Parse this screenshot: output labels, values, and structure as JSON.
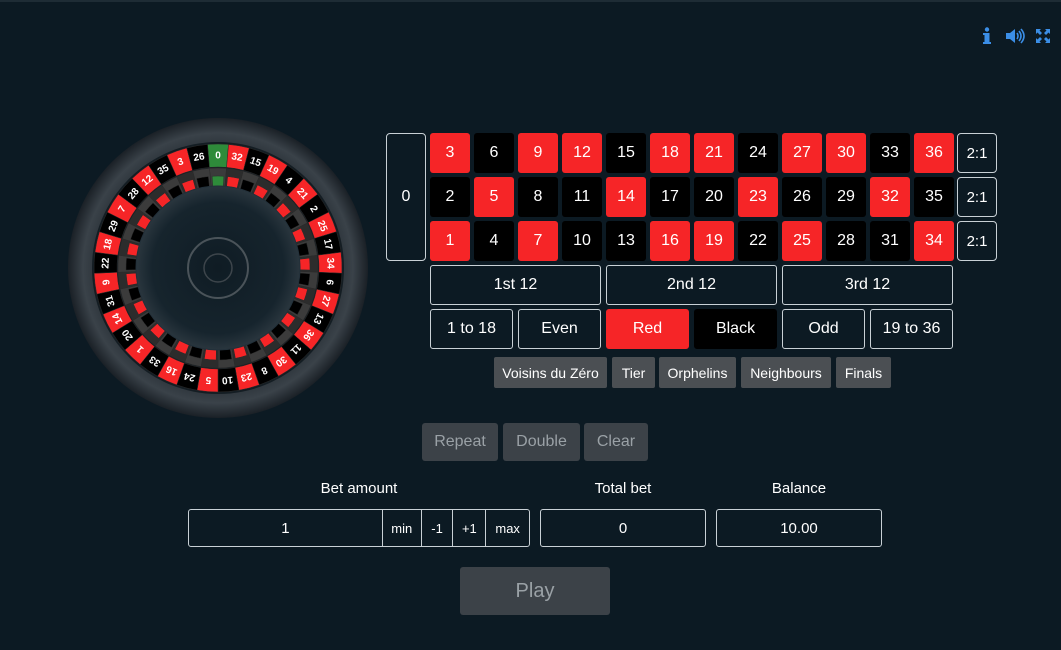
{
  "toolbar": {
    "info_icon": "info-icon",
    "sound_icon": "sound-icon",
    "fullscreen_icon": "fullscreen-icon"
  },
  "wheel": {
    "sequence": [
      "0",
      "32",
      "15",
      "19",
      "4",
      "21",
      "2",
      "25",
      "17",
      "34",
      "6",
      "27",
      "13",
      "36",
      "11",
      "30",
      "8",
      "23",
      "10",
      "5",
      "24",
      "16",
      "33",
      "1",
      "20",
      "14",
      "31",
      "9",
      "22",
      "18",
      "29",
      "7",
      "28",
      "12",
      "35",
      "3",
      "26"
    ],
    "colors": {
      "red": "#f62527",
      "black": "#000000",
      "green": "#2e8b3a"
    }
  },
  "table": {
    "zero": "0",
    "rows": [
      [
        {
          "n": "3",
          "c": "red"
        },
        {
          "n": "6",
          "c": "black"
        },
        {
          "n": "9",
          "c": "red"
        },
        {
          "n": "12",
          "c": "red"
        },
        {
          "n": "15",
          "c": "black"
        },
        {
          "n": "18",
          "c": "red"
        },
        {
          "n": "21",
          "c": "red"
        },
        {
          "n": "24",
          "c": "black"
        },
        {
          "n": "27",
          "c": "red"
        },
        {
          "n": "30",
          "c": "red"
        },
        {
          "n": "33",
          "c": "black"
        },
        {
          "n": "36",
          "c": "red"
        }
      ],
      [
        {
          "n": "2",
          "c": "black"
        },
        {
          "n": "5",
          "c": "red"
        },
        {
          "n": "8",
          "c": "black"
        },
        {
          "n": "11",
          "c": "black"
        },
        {
          "n": "14",
          "c": "red"
        },
        {
          "n": "17",
          "c": "black"
        },
        {
          "n": "20",
          "c": "black"
        },
        {
          "n": "23",
          "c": "red"
        },
        {
          "n": "26",
          "c": "black"
        },
        {
          "n": "29",
          "c": "black"
        },
        {
          "n": "32",
          "c": "red"
        },
        {
          "n": "35",
          "c": "black"
        }
      ],
      [
        {
          "n": "1",
          "c": "red"
        },
        {
          "n": "4",
          "c": "black"
        },
        {
          "n": "7",
          "c": "red"
        },
        {
          "n": "10",
          "c": "black"
        },
        {
          "n": "13",
          "c": "black"
        },
        {
          "n": "16",
          "c": "red"
        },
        {
          "n": "19",
          "c": "red"
        },
        {
          "n": "22",
          "c": "black"
        },
        {
          "n": "25",
          "c": "red"
        },
        {
          "n": "28",
          "c": "black"
        },
        {
          "n": "31",
          "c": "black"
        },
        {
          "n": "34",
          "c": "red"
        }
      ]
    ],
    "columns": [
      "2:1",
      "2:1",
      "2:1"
    ],
    "dozens": [
      "1st 12",
      "2nd 12",
      "3rd 12"
    ],
    "outside": [
      "1 to 18",
      "Even",
      "Red",
      "Black",
      "Odd",
      "19 to 36"
    ]
  },
  "special_bets": [
    "Voisins du Zéro",
    "Tier",
    "Orphelins",
    "Neighbours",
    "Finals"
  ],
  "actions": {
    "repeat": "Repeat",
    "double": "Double",
    "clear": "Clear"
  },
  "bet": {
    "label": "Bet amount",
    "value": "1",
    "min": "min",
    "minus": "-1",
    "plus": "+1",
    "max": "max"
  },
  "total": {
    "label": "Total bet",
    "value": "0"
  },
  "balance": {
    "label": "Balance",
    "value": "10.00"
  },
  "play": "Play"
}
